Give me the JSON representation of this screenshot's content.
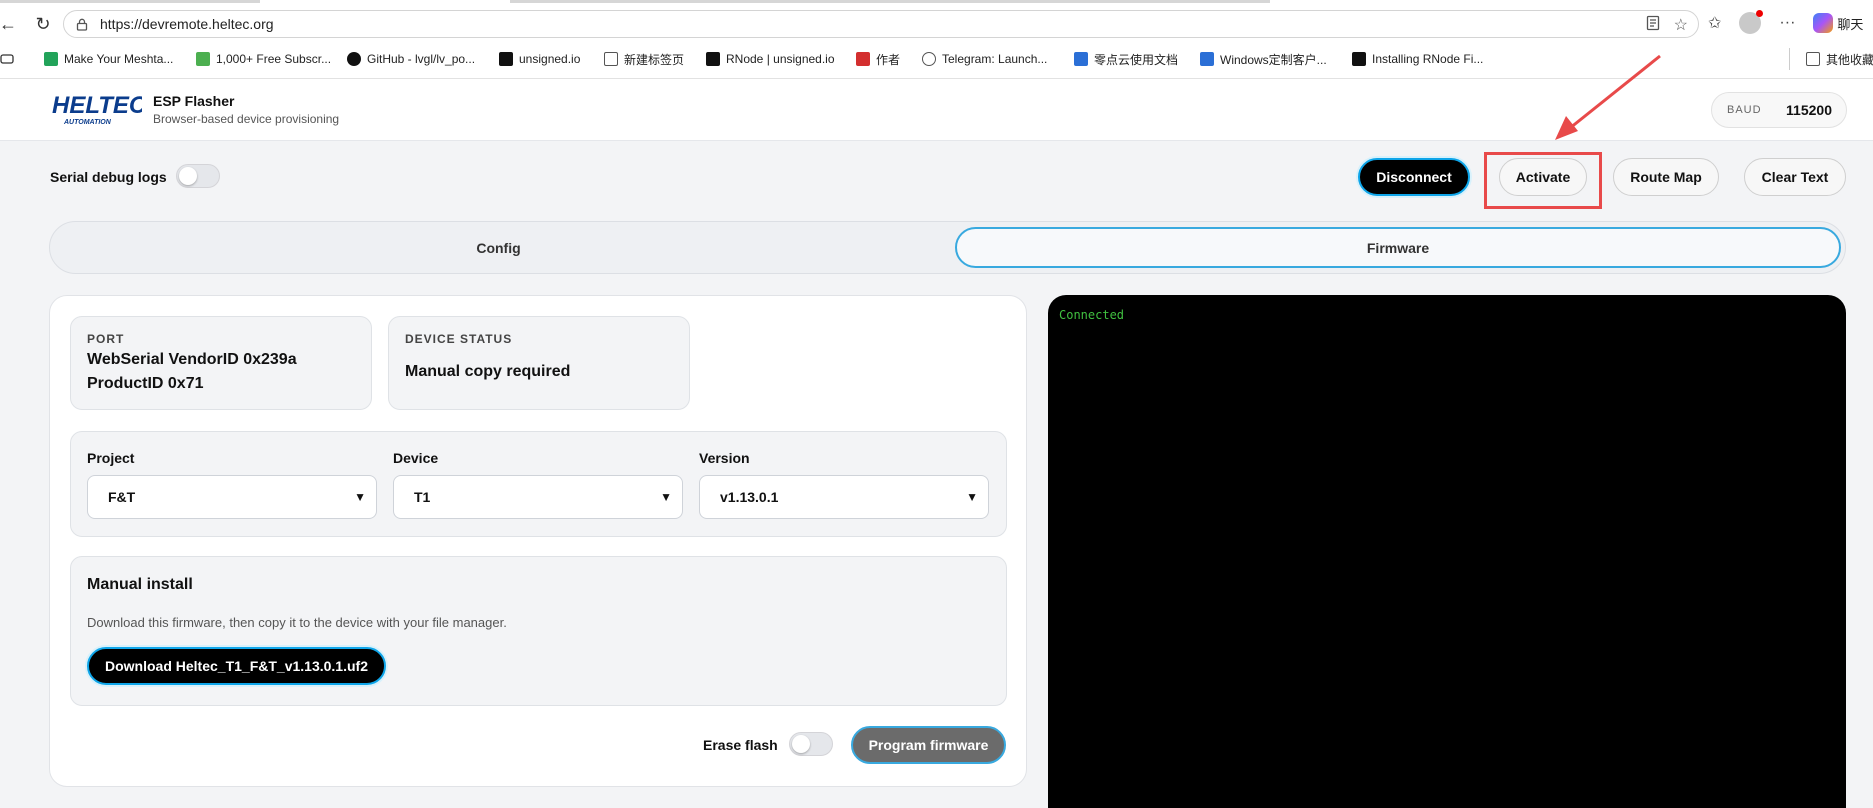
{
  "browser": {
    "url": "https://devremote.heltec.org",
    "copilot_label": "聊天",
    "other_bookmarks": "其他收藏夹",
    "bookmarks": [
      {
        "label": "Make Your Meshta...",
        "icon": "green-chart-icon",
        "color": "#22a35a"
      },
      {
        "label": "1,000+ Free Subscr...",
        "icon": "px-icon",
        "color": "#4caf50"
      },
      {
        "label": "GitHub - lvgl/lv_po...",
        "icon": "github-icon",
        "color": "#111111"
      },
      {
        "label": "unsigned.io",
        "icon": "unsigned-icon",
        "color": "#111111"
      },
      {
        "label": "新建标签页",
        "icon": "newtab-icon",
        "color": "#555555"
      },
      {
        "label": "RNode | unsigned.io",
        "icon": "unsigned-icon",
        "color": "#111111"
      },
      {
        "label": "作者",
        "icon": "pdf-icon",
        "color": "#d32f2f"
      },
      {
        "label": "Telegram: Launch...",
        "icon": "globe-icon",
        "color": "#555555"
      },
      {
        "label": "零点云使用文档",
        "icon": "doc-icon",
        "color": "#2b6fd6"
      },
      {
        "label": "Windows定制客户...",
        "icon": "doc-icon",
        "color": "#2b6fd6"
      },
      {
        "label": "Installing RNode Fi...",
        "icon": "unsigned-icon",
        "color": "#111111"
      }
    ]
  },
  "header": {
    "title": "ESP Flasher",
    "subtitle": "Browser-based device provisioning",
    "baud_label": "BAUD",
    "baud_value": "115200",
    "logo_text": "HELTEC",
    "logo_subtext": "AUTOMATION"
  },
  "controls": {
    "debug_label": "Serial debug logs",
    "disconnect": "Disconnect",
    "activate": "Activate",
    "route_map": "Route Map",
    "clear_text": "Clear Text"
  },
  "tabs": [
    {
      "label": "Config",
      "active": false
    },
    {
      "label": "Firmware",
      "active": true
    }
  ],
  "port": {
    "caption": "PORT",
    "line1": "WebSerial VendorID 0x239a",
    "line2": "ProductID 0x71"
  },
  "device_status": {
    "caption": "DEVICE STATUS",
    "value": "Manual copy required"
  },
  "selectors": {
    "project_label": "Project",
    "project_value": "F&T",
    "device_label": "Device",
    "device_value": "T1",
    "version_label": "Version",
    "version_value": "v1.13.0.1"
  },
  "manual": {
    "title": "Manual install",
    "description": "Download this firmware, then copy it to the device with your file manager.",
    "download_label": "Download Heltec_T1_F&T_v1.13.0.1.uf2"
  },
  "program": {
    "erase_label": "Erase flash",
    "program_label": "Program firmware"
  },
  "terminal": {
    "line": "Connected"
  },
  "colors": {
    "accent": "#0ea5e9",
    "highlight": "#e84a4a",
    "terminal_text": "#40c040"
  }
}
